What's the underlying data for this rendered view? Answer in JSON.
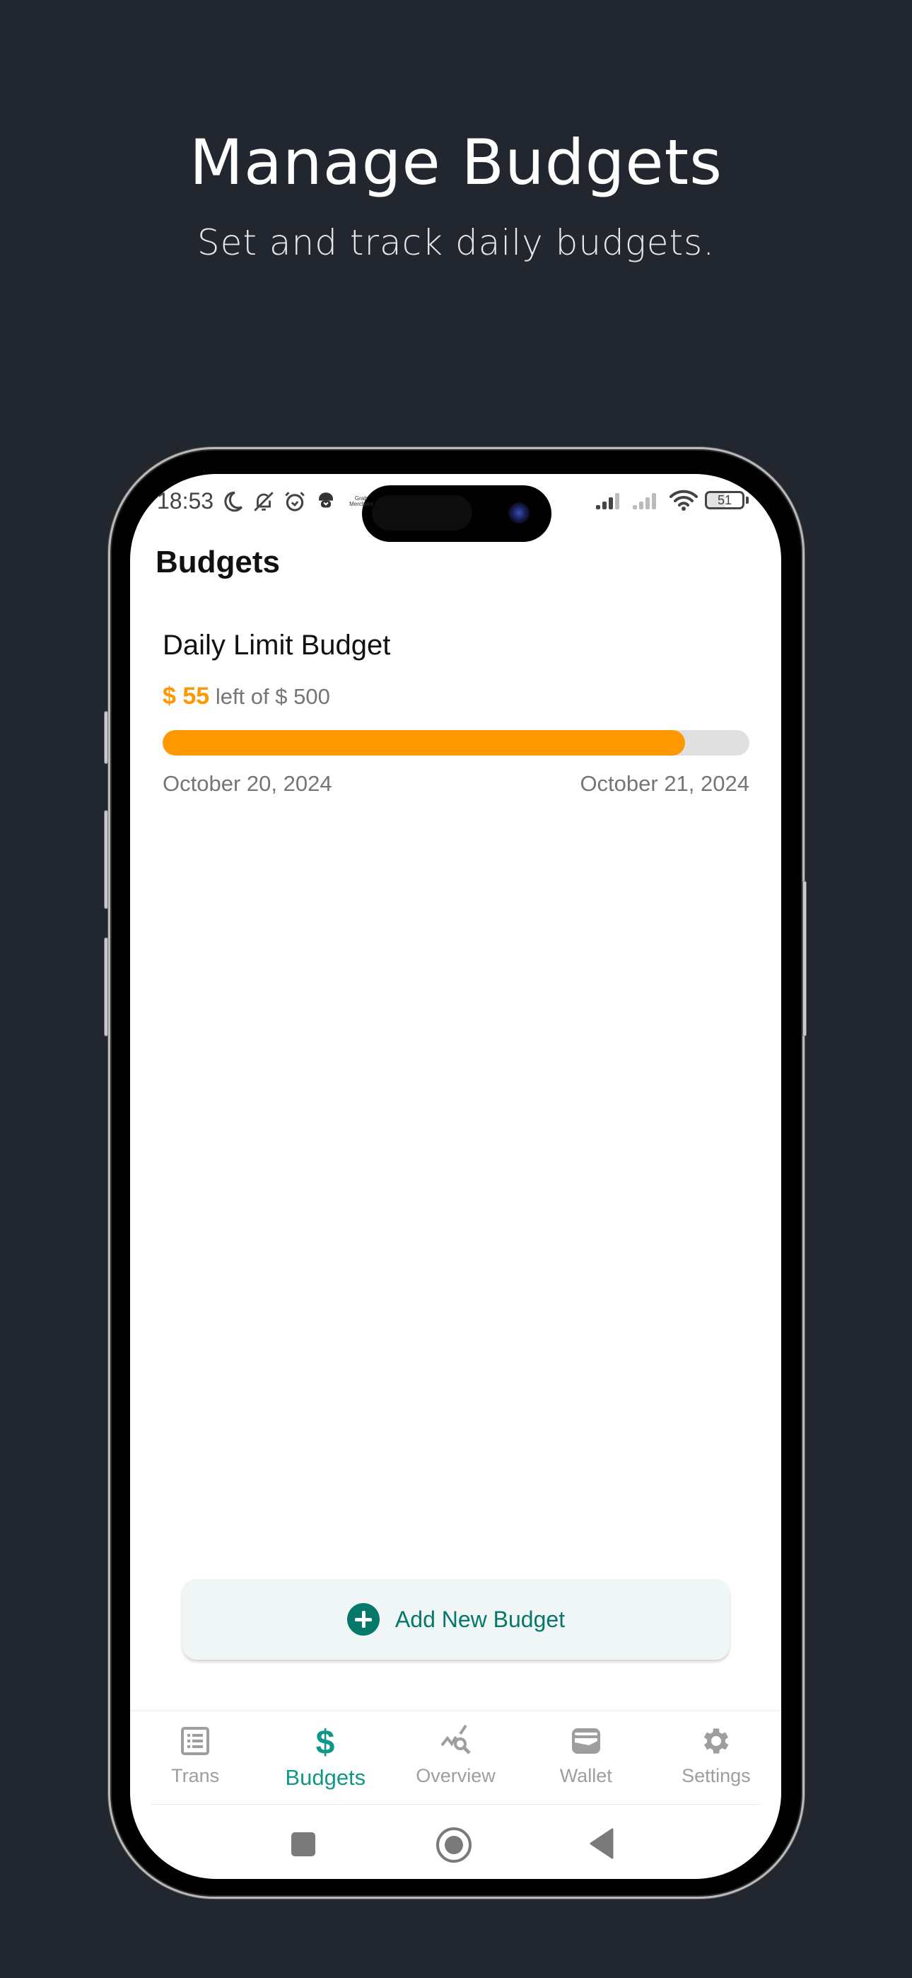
{
  "promo": {
    "title": "Manage Budgets",
    "subtitle": "Set and track daily budgets."
  },
  "status_bar": {
    "time": "18:53",
    "icons_left": [
      "moon-icon",
      "bell-off-icon",
      "alarm-icon",
      "grab-app-icon"
    ],
    "grab_label_line1": "Grab",
    "grab_label_line2": "Merchant",
    "icons_right": [
      "signal-icon",
      "signal-weak-icon",
      "wifi-icon",
      "battery-icon"
    ],
    "battery_level": "51"
  },
  "app": {
    "title": "Budgets",
    "budget": {
      "name": "Daily Limit Budget",
      "left_amount": "$ 55",
      "left_of_text": "left of $ 500",
      "spent_fraction": 0.89,
      "start_date": "October 20, 2024",
      "end_date": "October 21, 2024"
    },
    "add_button_label": "Add New Budget"
  },
  "bottom_nav": {
    "items": [
      {
        "label": "Trans",
        "icon": "list-icon",
        "active": false
      },
      {
        "label": "Budgets",
        "icon": "dollar-icon",
        "active": true
      },
      {
        "label": "Overview",
        "icon": "chart-search-icon",
        "active": false
      },
      {
        "label": "Wallet",
        "icon": "wallet-icon",
        "active": false
      },
      {
        "label": "Settings",
        "icon": "gear-icon",
        "active": false
      }
    ]
  },
  "colors": {
    "background": "#22262e",
    "accent": "#06786a",
    "nav_active": "#11968a",
    "progress": "#ff9800",
    "progress_track": "#e0e0e0"
  }
}
